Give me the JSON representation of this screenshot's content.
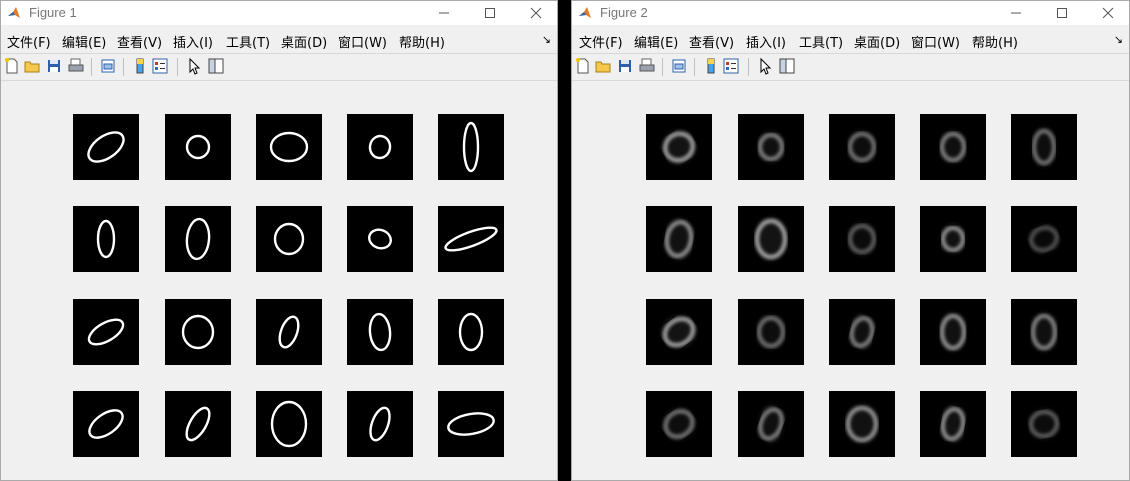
{
  "figure1": {
    "title": "Figure 1",
    "menu": [
      "文件(F)",
      "编辑(E)",
      "查看(V)",
      "插入(I)",
      "工具(T)",
      "桌面(D)",
      "窗口(W)",
      "帮助(H)"
    ],
    "menu_overflow": "↘",
    "toolbar": [
      "new-figure-icon",
      "open-file-icon",
      "save-icon",
      "print-icon",
      "link-plot-icon",
      "colorbar-icon",
      "legend-icon",
      "edit-plot-icon",
      "property-inspector-icon"
    ],
    "digits": [
      {
        "w": 20,
        "h": 11,
        "rot": -35,
        "c": "#fff"
      },
      {
        "w": 11,
        "h": 11,
        "rot": 0,
        "c": "#fff"
      },
      {
        "w": 18,
        "h": 14,
        "rot": 0,
        "c": "#fff"
      },
      {
        "w": 10,
        "h": 11,
        "rot": 10,
        "c": "#fff"
      },
      {
        "w": 7,
        "h": 24,
        "rot": 0,
        "c": "#fff"
      },
      {
        "w": 8,
        "h": 18,
        "rot": 0,
        "c": "#fff"
      },
      {
        "w": 11,
        "h": 20,
        "rot": 5,
        "c": "#fff"
      },
      {
        "w": 14,
        "h": 15,
        "rot": 0,
        "c": "#fff"
      },
      {
        "w": 11,
        "h": 9,
        "rot": 20,
        "c": "#fff"
      },
      {
        "w": 27,
        "h": 7,
        "rot": -20,
        "c": "#fff"
      },
      {
        "w": 19,
        "h": 9,
        "rot": -30,
        "c": "#fff"
      },
      {
        "w": 15,
        "h": 16,
        "rot": 0,
        "c": "#fff"
      },
      {
        "w": 8,
        "h": 16,
        "rot": 20,
        "c": "#fff"
      },
      {
        "w": 10,
        "h": 18,
        "rot": -5,
        "c": "#fff"
      },
      {
        "w": 11,
        "h": 18,
        "rot": 0,
        "c": "#fff"
      },
      {
        "w": 19,
        "h": 10,
        "rot": -35,
        "c": "#fff"
      },
      {
        "w": 8,
        "h": 18,
        "rot": 30,
        "c": "#fff"
      },
      {
        "w": 17,
        "h": 22,
        "rot": 0,
        "c": "#fff"
      },
      {
        "w": 8,
        "h": 17,
        "rot": 20,
        "c": "#fff"
      },
      {
        "w": 23,
        "h": 10,
        "rot": -10,
        "c": "#fff"
      }
    ]
  },
  "figure2": {
    "title": "Figure 2",
    "menu": [
      "文件(F)",
      "编辑(E)",
      "查看(V)",
      "插入(I)",
      "工具(T)",
      "桌面(D)",
      "窗口(W)",
      "帮助(H)"
    ],
    "menu_overflow": "↘",
    "toolbar": [
      "new-figure-icon",
      "open-file-icon",
      "save-icon",
      "print-icon",
      "link-plot-icon",
      "colorbar-icon",
      "legend-icon",
      "edit-plot-icon",
      "property-inspector-icon"
    ],
    "digits": [
      {
        "w": 14,
        "h": 13,
        "rot": -30,
        "c": "#9a9a9a"
      },
      {
        "w": 11,
        "h": 12,
        "rot": 0,
        "c": "#7a7a7a"
      },
      {
        "w": 12,
        "h": 13,
        "rot": 0,
        "c": "#6e6e6e"
      },
      {
        "w": 11,
        "h": 13,
        "rot": 0,
        "c": "#7a7a7a"
      },
      {
        "w": 10,
        "h": 16,
        "rot": 0,
        "c": "#6e6e6e"
      },
      {
        "w": 12,
        "h": 17,
        "rot": 10,
        "c": "#8a8a8a"
      },
      {
        "w": 14,
        "h": 18,
        "rot": 0,
        "c": "#9e9e9e"
      },
      {
        "w": 12,
        "h": 13,
        "rot": 0,
        "c": "#5a5a5a"
      },
      {
        "w": 10,
        "h": 11,
        "rot": 0,
        "c": "#8a8a8a"
      },
      {
        "w": 13,
        "h": 11,
        "rot": -20,
        "c": "#4e4e4e"
      },
      {
        "w": 15,
        "h": 12,
        "rot": -35,
        "c": "#9a9a9a"
      },
      {
        "w": 12,
        "h": 14,
        "rot": 0,
        "c": "#6a6a6a"
      },
      {
        "w": 10,
        "h": 14,
        "rot": 15,
        "c": "#7a7a7a"
      },
      {
        "w": 11,
        "h": 16,
        "rot": 0,
        "c": "#8a8a8a"
      },
      {
        "w": 11,
        "h": 16,
        "rot": 0,
        "c": "#7e7e7e"
      },
      {
        "w": 14,
        "h": 12,
        "rot": -35,
        "c": "#6e6e6e"
      },
      {
        "w": 10,
        "h": 15,
        "rot": 20,
        "c": "#7a7a7a"
      },
      {
        "w": 14,
        "h": 16,
        "rot": 0,
        "c": "#8e8e8e"
      },
      {
        "w": 10,
        "h": 15,
        "rot": 10,
        "c": "#8a8a8a"
      },
      {
        "w": 13,
        "h": 12,
        "rot": -10,
        "c": "#5a5a5a"
      }
    ]
  },
  "colors": {
    "window_bg": "#f0f0f0",
    "titlebar_bg": "#ffffff",
    "title_text": "#777777",
    "image_bg": "#000000"
  }
}
